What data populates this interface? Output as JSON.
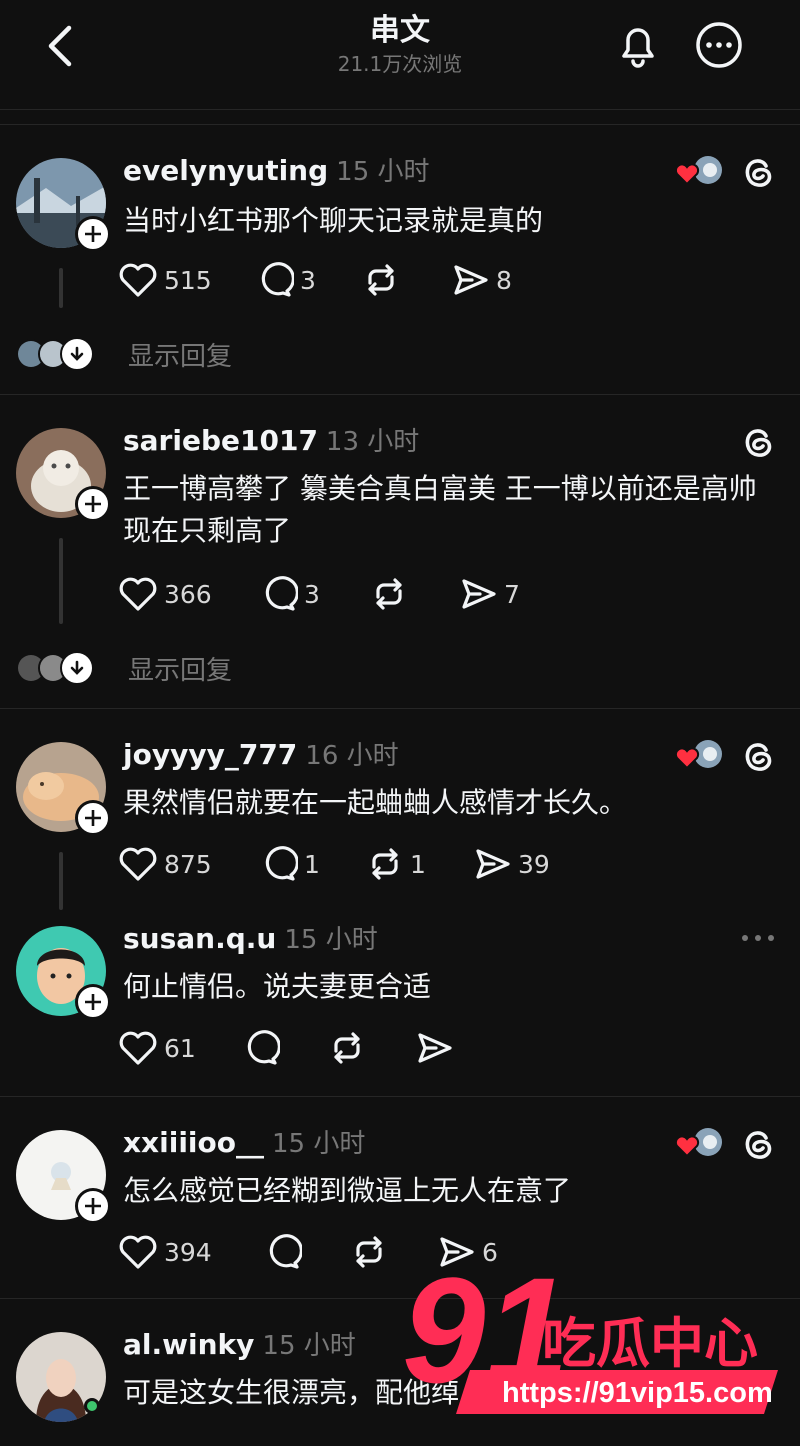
{
  "header": {
    "title": "串文",
    "views": "21.1万次浏览"
  },
  "posts": [
    {
      "username": "evelynyuting",
      "time": "15 小时",
      "text": "当时小红书那个聊天记录就是真的",
      "likes": "515",
      "comments": "3",
      "reposts": "",
      "shares": "8",
      "show_replies": "显示回复"
    },
    {
      "username": "sariebe1017",
      "time": "13 小时",
      "text": "王一博高攀了 纂美合真白富美 王一博以前还是高帅 现在只剩高了",
      "likes": "366",
      "comments": "3",
      "reposts": "",
      "shares": "7",
      "show_replies": "显示回复"
    },
    {
      "username": "joyyyy_777",
      "time": "16 小时",
      "text": "果然情侣就要在一起蛐蛐人感情才长久。",
      "likes": "875",
      "comments": "1",
      "reposts": "1",
      "shares": "39"
    },
    {
      "username": "susan.q.u",
      "time": "15 小时",
      "text": "何止情侣。说夫妻更合适",
      "likes": "61",
      "comments": "",
      "reposts": "",
      "shares": ""
    },
    {
      "username": "xxiiiioo__",
      "time": "15 小时",
      "text": "怎么感觉已经糊到微逼上无人在意了",
      "likes": "394",
      "comments": "",
      "reposts": "",
      "shares": "6"
    },
    {
      "username": "al.winky",
      "time": "15 小时",
      "text": "可是这女生很漂亮，配他绰"
    }
  ],
  "watermark": {
    "brand": "91吃瓜中心",
    "url": "https://91vip15.com"
  },
  "colors": {
    "background": "#101010",
    "text": "#f3f5f7",
    "muted": "#777777",
    "heart": "#ff3040",
    "watermark": "#ff2d55"
  },
  "icons": [
    "back-chevron-icon",
    "bell-icon",
    "more-circle-icon",
    "heart-icon",
    "comment-icon",
    "repost-icon",
    "share-icon",
    "threads-icon",
    "plus-icon",
    "chevron-down-icon"
  ]
}
